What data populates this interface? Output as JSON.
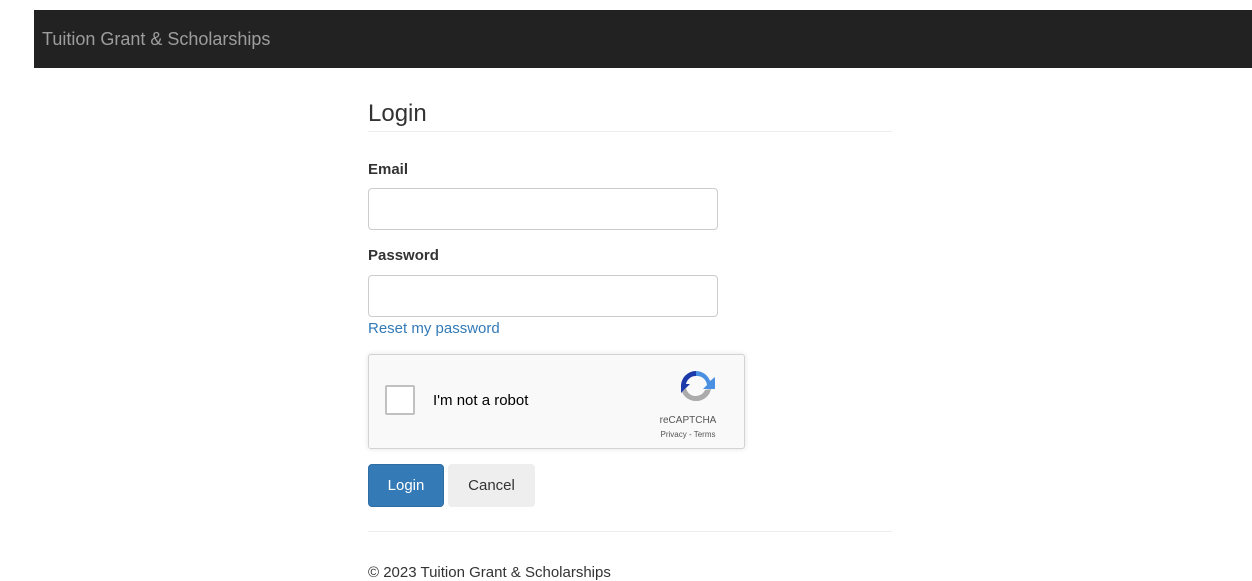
{
  "navbar": {
    "brand": "Tuition Grant & Scholarships"
  },
  "login": {
    "title": "Login",
    "email_label": "Email",
    "email_value": "",
    "password_label": "Password",
    "password_value": "",
    "reset_link": "Reset my password",
    "recaptcha": {
      "label": "I'm not a robot",
      "brand": "reCAPTCHA",
      "links": "Privacy - Terms",
      "checked": false,
      "logo_icon": "recaptcha-logo-icon"
    },
    "submit_label": "Login",
    "cancel_label": "Cancel"
  },
  "footer": {
    "copyright": "© 2023 Tuition Grant & Scholarships"
  },
  "colors": {
    "navbar_bg": "#222222",
    "brand_text": "#9d9d9d",
    "primary": "#337ab7",
    "link": "#337ab7",
    "default_button": "#eeeeee"
  }
}
